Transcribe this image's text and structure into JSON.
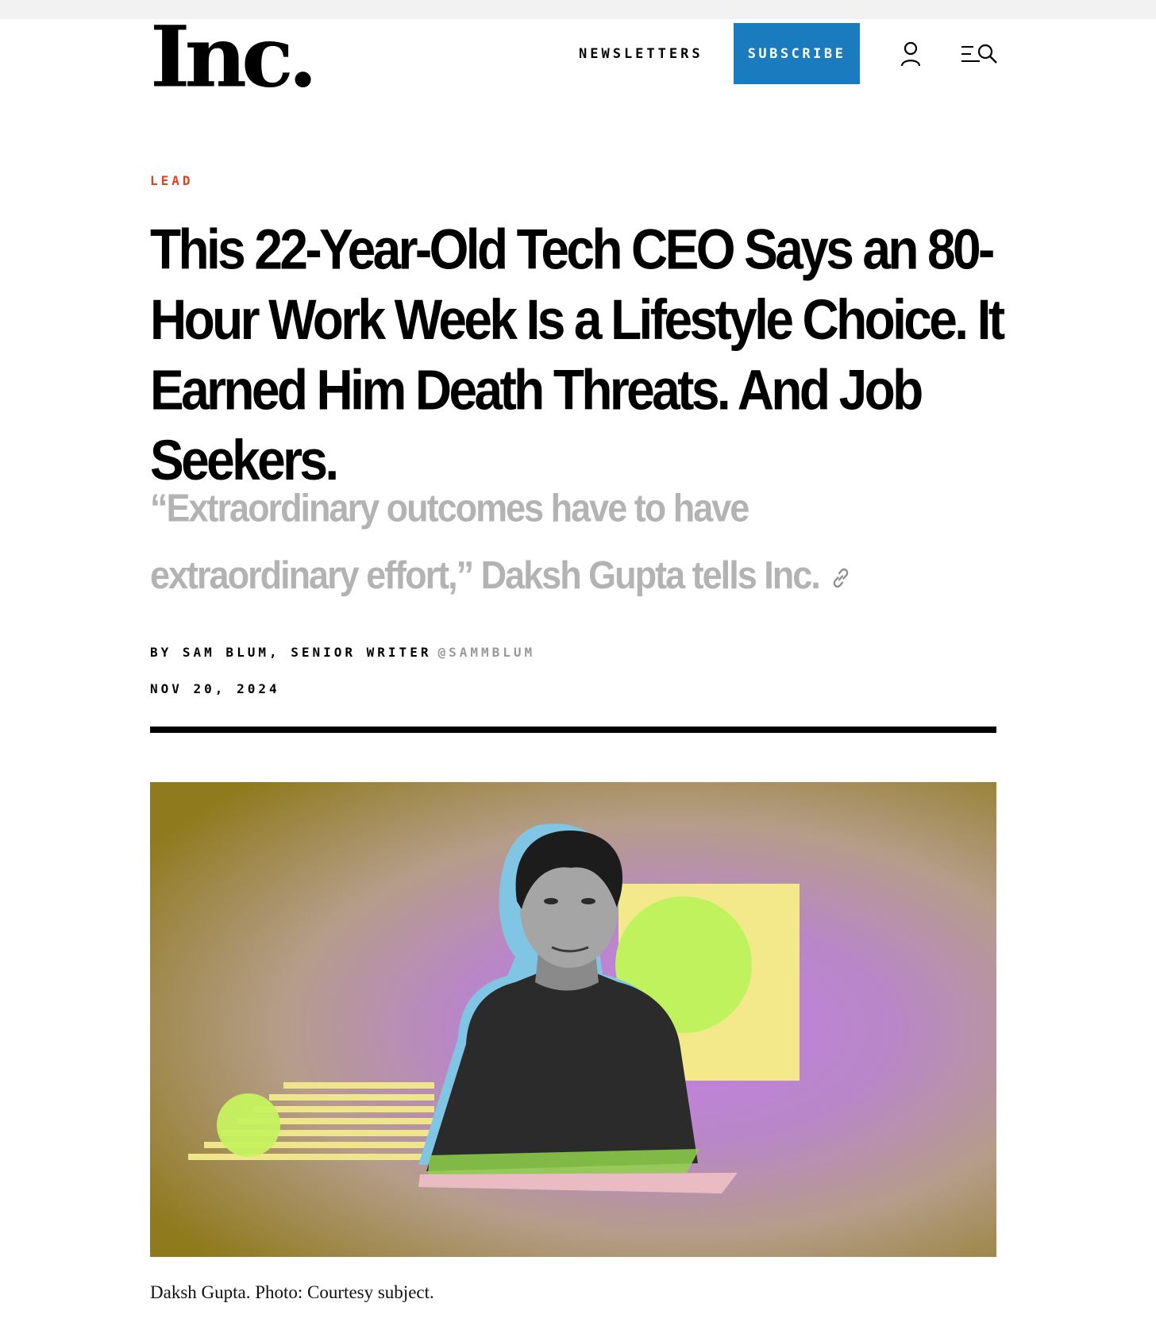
{
  "header": {
    "logo": "Inc.",
    "newsletters_label": "NEWSLETTERS",
    "subscribe_label": "SUBSCRIBE",
    "icons": [
      "user-icon",
      "menu-search-icon"
    ],
    "accent_color": "#1a7cbf"
  },
  "article": {
    "kicker": "LEAD",
    "kicker_color": "#e0411f",
    "headline": "This 22-Year-Old Tech CEO Says an 80-Hour Work Week Is a Lifestyle Choice. It Earned Him Death Threats. And Job Seekers.",
    "dek": "“Extraordinary outcomes have to have extraordinary effort,” Daksh Gupta tells Inc.",
    "byline": "BY SAM BLUM, SENIOR WRITER",
    "handle": "@SAMMBLUM",
    "date": "NOV 20, 2024",
    "link_icon": "link-icon"
  },
  "hero": {
    "caption": "Daksh Gupta. Photo: Courtesy subject."
  }
}
